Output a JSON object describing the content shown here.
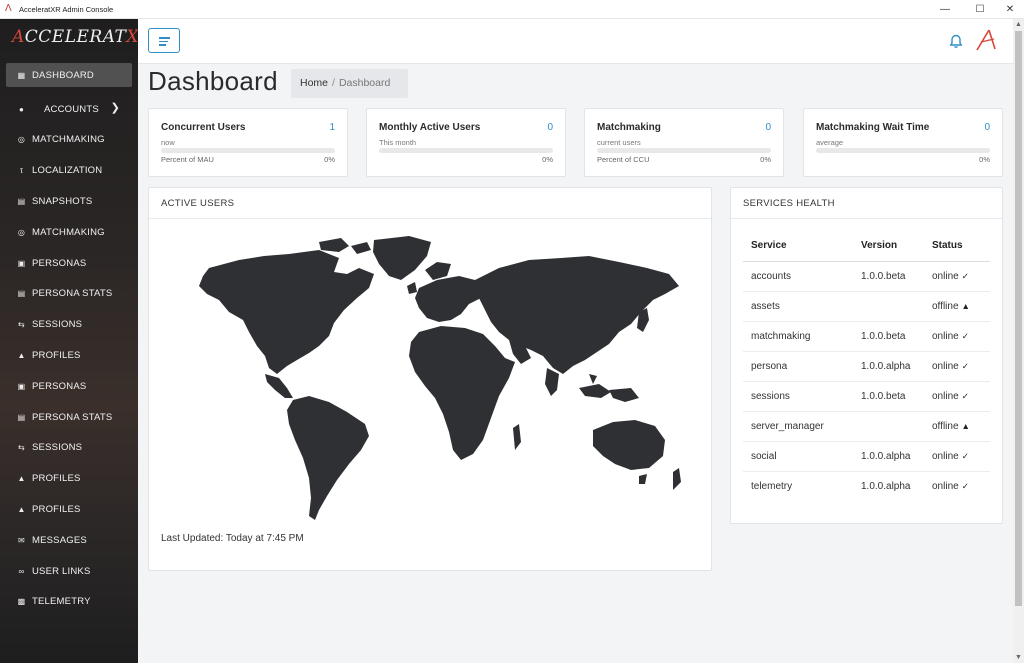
{
  "window": {
    "title": "AcceleratXR Admin Console"
  },
  "brand": {
    "logo_text": "AcceleratXR",
    "accent": "#d9473a"
  },
  "sidebar": {
    "items": [
      {
        "label": "DASHBOARD",
        "icon": "dashboard-icon",
        "active": true
      },
      {
        "label": "ACCOUNTS",
        "icon": "account-circle-icon",
        "has_children": true
      },
      {
        "label": "MATCHMAKING",
        "icon": "globe-icon"
      },
      {
        "label": "LOCALIZATION",
        "icon": "text-size-icon"
      },
      {
        "label": "SNAPSHOTS",
        "icon": "stack-icon"
      },
      {
        "label": "MATCHMAKING",
        "icon": "globe-icon"
      },
      {
        "label": "PERSONAS",
        "icon": "contact-card-icon"
      },
      {
        "label": "PERSONA STATS",
        "icon": "stats-box-icon"
      },
      {
        "label": "SESSIONS",
        "icon": "swap-icon"
      },
      {
        "label": "PROFILES",
        "icon": "person-icon"
      },
      {
        "label": "PERSONAS",
        "icon": "contact-card-icon"
      },
      {
        "label": "PERSONA STATS",
        "icon": "stats-box-icon"
      },
      {
        "label": "SESSIONS",
        "icon": "swap-icon"
      },
      {
        "label": "PROFILES",
        "icon": "person-icon"
      },
      {
        "label": "PROFILES",
        "icon": "person-icon"
      },
      {
        "label": "MESSAGES",
        "icon": "envelope-icon"
      },
      {
        "label": "USER LINKS",
        "icon": "link-icon"
      },
      {
        "label": "TELEMETRY",
        "icon": "chart-box-icon"
      }
    ]
  },
  "page": {
    "title": "Dashboard",
    "breadcrumb": {
      "home": "Home",
      "separator": "/",
      "current": "Dashboard"
    }
  },
  "stats": [
    {
      "title": "Concurrent Users",
      "value": "1",
      "subtitle": "now",
      "footer": "Percent of MAU",
      "percent_label": "0%",
      "percent": 0
    },
    {
      "title": "Monthly Active Users",
      "value": "0",
      "subtitle": "This month",
      "footer": "",
      "percent_label": "0%",
      "percent": 0
    },
    {
      "title": "Matchmaking",
      "value": "0",
      "subtitle": "current users",
      "footer": "Percent of CCU",
      "percent_label": "0%",
      "percent": 0
    },
    {
      "title": "Matchmaking Wait Time",
      "value": "0",
      "subtitle": "average",
      "footer": "",
      "percent_label": "0%",
      "percent": 0
    }
  ],
  "active_users": {
    "header": "ACTIVE USERS",
    "last_updated": "Last Updated: Today at 7:45 PM",
    "map_color": "#2f3033"
  },
  "services_health": {
    "header": "SERVICES HEALTH",
    "columns": [
      "Service",
      "Version",
      "Status"
    ],
    "rows": [
      {
        "service": "accounts",
        "version": "1.0.0.beta",
        "status": "online",
        "icon": "check-icon"
      },
      {
        "service": "assets",
        "version": "",
        "status": "offline",
        "icon": "warning-icon"
      },
      {
        "service": "matchmaking",
        "version": "1.0.0.beta",
        "status": "online",
        "icon": "check-icon"
      },
      {
        "service": "persona",
        "version": "1.0.0.alpha",
        "status": "online",
        "icon": "check-icon"
      },
      {
        "service": "sessions",
        "version": "1.0.0.beta",
        "status": "online",
        "icon": "check-icon"
      },
      {
        "service": "server_manager",
        "version": "",
        "status": "offline",
        "icon": "warning-icon"
      },
      {
        "service": "social",
        "version": "1.0.0.alpha",
        "status": "online",
        "icon": "check-icon"
      },
      {
        "service": "telemetry",
        "version": "1.0.0.alpha",
        "status": "online",
        "icon": "check-icon"
      }
    ]
  },
  "colors": {
    "primary": "#2e8fc6",
    "sidebar_bg": "#2a2625",
    "page_bg": "#f3f4f6"
  }
}
